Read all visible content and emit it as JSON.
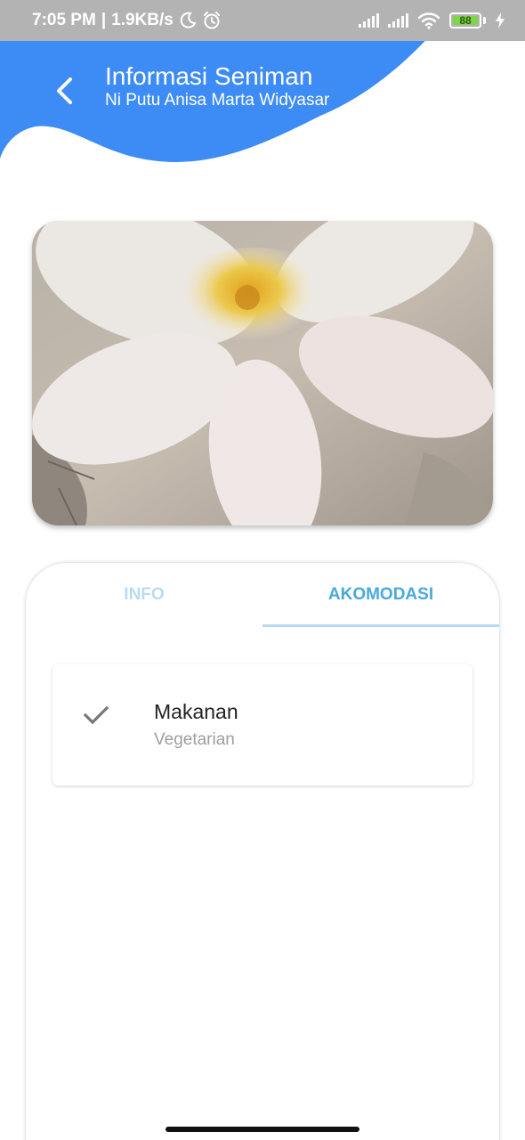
{
  "status_bar": {
    "time": "7:05 PM",
    "network_speed": "1.9KB/s",
    "battery_level": "88",
    "icons": [
      "moon-icon",
      "alarm-icon",
      "signal-icon",
      "wifi-icon",
      "battery-icon",
      "charging-icon"
    ]
  },
  "header": {
    "title": "Informasi Seniman",
    "subtitle": "Ni Putu Anisa Marta Widyasari"
  },
  "tabs": [
    {
      "label": "INFO",
      "selected": false
    },
    {
      "label": "AKOMODASI",
      "selected": true
    }
  ],
  "accommodation": {
    "items": [
      {
        "title": "Makanan",
        "subtitle": "Vegetarian",
        "icon": "check-icon"
      }
    ]
  },
  "colors": {
    "primary": "#3d8cf5",
    "tab_active": "#4aa8e0",
    "tab_inactive": "#b9dcf3",
    "status_bar": "#b3b3b3"
  }
}
